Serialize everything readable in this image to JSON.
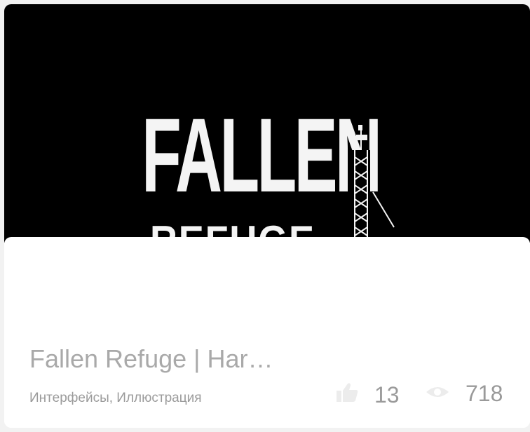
{
  "cover": {
    "logo_line1": "FALLEN",
    "logo_line2": "REFUGE"
  },
  "project": {
    "title": "Fallen Refuge | Har…",
    "tags": "Интерфейсы, Иллюстрация"
  },
  "stats": {
    "likes": "13",
    "views": "718",
    "like_icon": "thumbs-up-icon",
    "view_icon": "eye-icon"
  },
  "colors": {
    "cover_bg": "#000000",
    "card_bg": "#ffffff",
    "text_muted": "#a9a9a9",
    "icon_muted": "#ececec"
  }
}
